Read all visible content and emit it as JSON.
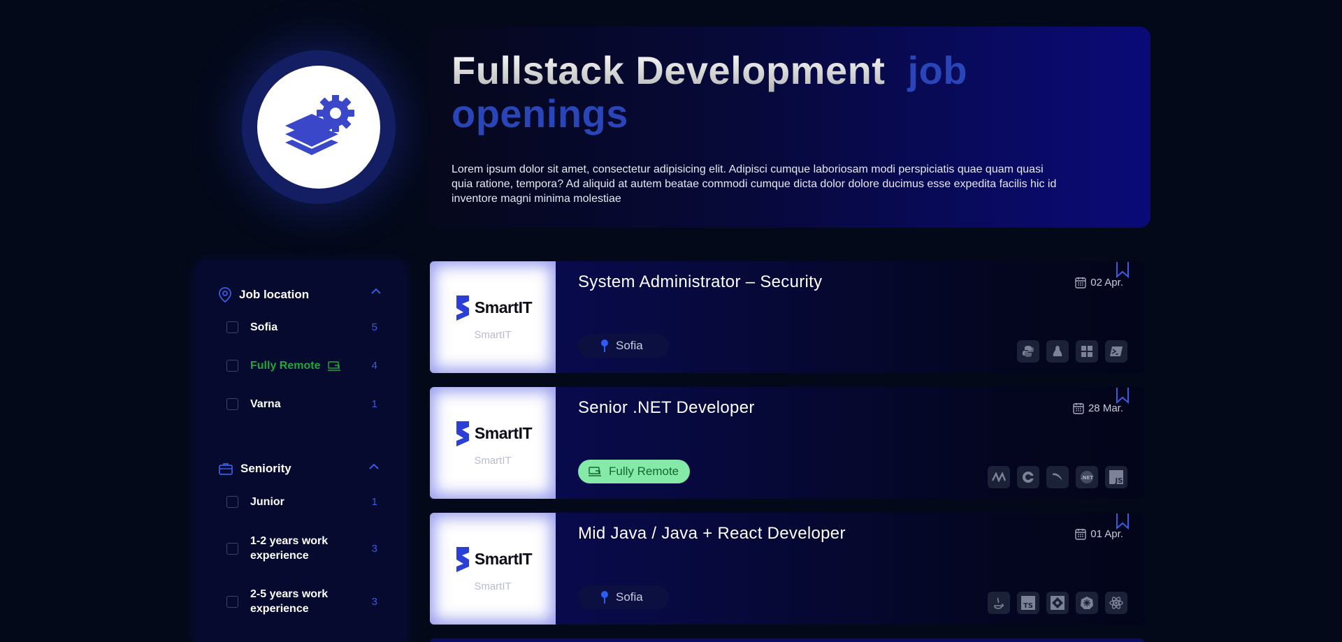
{
  "hero": {
    "title_main": "Fullstack Development",
    "title_accent": "job openings",
    "description": "Lorem ipsum dolor sit amet, consectetur adipisicing elit. Adipisci cumque laboriosam modi perspiciatis quae quam quasi quia ratione, tempora? Ad aliquid at autem beatae commodi cumque dicta dolor dolore ducimus esse expedita facilis hic id inventore magni minima molestiae",
    "icon": "layers-gear-icon"
  },
  "filters": {
    "location": {
      "title": "Job location",
      "icon": "map-pin-icon",
      "options": [
        {
          "label": "Sofia",
          "count": "5"
        },
        {
          "label": "Fully Remote",
          "count": "4"
        },
        {
          "label": "Varna",
          "count": "1"
        }
      ]
    },
    "seniority": {
      "title": "Seniority",
      "icon": "briefcase-icon",
      "options": [
        {
          "label": "Junior",
          "count": "1"
        },
        {
          "label": "1-2 years work experience",
          "count": "3"
        },
        {
          "label": "2-5 years work experience",
          "count": "3"
        }
      ]
    }
  },
  "jobs": [
    {
      "title": "System Administrator – Security",
      "date": "02 Apr.",
      "company": "SmartIT",
      "company_sub": "SmartIT",
      "location": "Sofia",
      "tech": [
        "python-icon",
        "linux-icon",
        "windows-icon",
        "powershell-icon"
      ]
    },
    {
      "title": "Senior .NET Developer",
      "date": "28 Mar.",
      "company": "SmartIT",
      "company_sub": "SmartIT",
      "location": "Fully Remote",
      "tech": [
        "nhibernate-icon",
        "csharp-icon",
        "mysql-icon",
        "dotnet-icon",
        "javascript-icon"
      ]
    },
    {
      "title": "Mid Java / Java + React Developer",
      "date": "01 Apr.",
      "company": "SmartIT",
      "company_sub": "SmartIT",
      "location": "Sofia",
      "tech": [
        "java-icon",
        "typescript-icon",
        "git-icon",
        "kubernetes-icon",
        "react-icon"
      ]
    }
  ],
  "colors": {
    "background": "#04091a",
    "accent": "#2a45b8",
    "count": "#3a5ce0",
    "remote_green": "#22a53b",
    "remote_pill": "#85eaa8"
  }
}
